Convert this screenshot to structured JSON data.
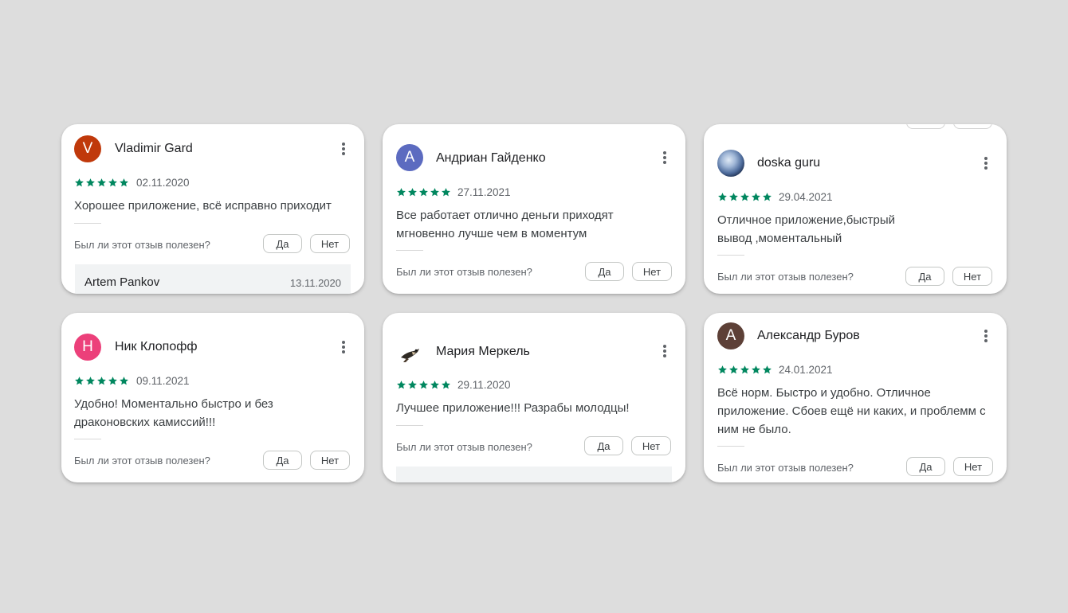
{
  "colors": {
    "page_bg": "#dddddd",
    "star": "#01875f",
    "avatar_vladimir": "#c0390b",
    "avatar_andrian": "#5c6bc0",
    "avatar_nik": "#ec407a",
    "avatar_aleksandr": "#5d4037"
  },
  "helpful_question": "Был ли этот отзыв полезен?",
  "yes_label": "Да",
  "no_label": "Нет",
  "reviews": [
    {
      "author": "Vladimir Gard",
      "avatar_letter": "V",
      "rating": 5,
      "date": "02.11.2020",
      "text": "Хорошее приложение, всё исправно приходит",
      "reply": {
        "author": "Artem Pankov",
        "date": "13.11.2020"
      }
    },
    {
      "author": "Андриан Гайденко",
      "avatar_letter": "А",
      "rating": 5,
      "date": "27.11.2021",
      "text": "Все работает отлично деньги приходят мгновенно лучше чем в моментум"
    },
    {
      "author": "doska guru",
      "avatar_icon": "earth-photo-avatar",
      "rating": 5,
      "date": "29.04.2021",
      "text": "Отличное приложение,быстрый вывод ,моментальный"
    },
    {
      "author": "Ник Клопофф",
      "avatar_letter": "Н",
      "rating": 5,
      "date": "09.11.2021",
      "text": "Удобно! Моментально быстро и без драконовских камиссий!!!"
    },
    {
      "author": "Мария Меркель",
      "avatar_icon": "bird-photo-avatar",
      "rating": 5,
      "date": "29.11.2020",
      "text": "Лучшее приложение!!! Разрабы молодцы!"
    },
    {
      "author": "Александр Буров",
      "avatar_letter": "А",
      "rating": 5,
      "date": "24.01.2021",
      "text": "Всё норм. Быстро и удобно. Отличное приложение. Сбоев ещё ни каких, и проблемм с ним не было."
    }
  ]
}
